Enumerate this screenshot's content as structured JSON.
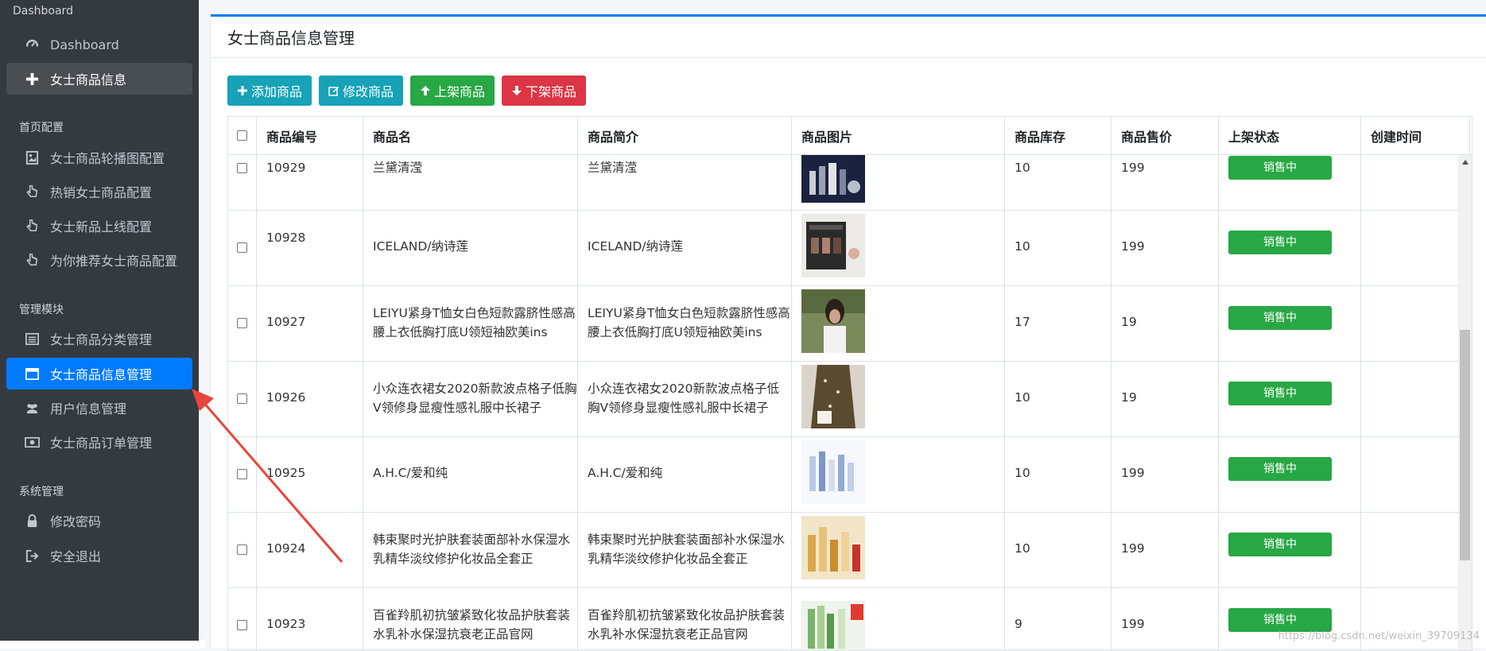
{
  "sidebar": {
    "top_header": "Dashboard",
    "items_main": [
      {
        "label": "Dashboard",
        "icon": "dashboard-icon"
      },
      {
        "label": "女士商品信息",
        "icon": "plus-icon"
      }
    ],
    "section_home": "首页配置",
    "items_home": [
      {
        "label": "女士商品轮播图配置",
        "icon": "image-icon"
      },
      {
        "label": "热销女士商品配置",
        "icon": "hand-pointer-icon"
      },
      {
        "label": "女士新品上线配置",
        "icon": "hand-pointer-icon"
      },
      {
        "label": "为你推荐女士商品配置",
        "icon": "hand-pointer-icon"
      }
    ],
    "section_manage": "管理模块",
    "items_manage": [
      {
        "label": "女士商品分类管理",
        "icon": "list-icon"
      },
      {
        "label": "女士商品信息管理",
        "icon": "window-icon"
      },
      {
        "label": "用户信息管理",
        "icon": "users-icon"
      },
      {
        "label": "女士商品订单管理",
        "icon": "money-icon"
      }
    ],
    "section_system": "系统管理",
    "items_system": [
      {
        "label": "修改密码",
        "icon": "lock-icon"
      },
      {
        "label": "安全退出",
        "icon": "sign-out-icon"
      }
    ]
  },
  "card": {
    "title": "女士商品信息管理"
  },
  "toolbar": {
    "add_label": "添加商品",
    "edit_label": "修改商品",
    "up_label": "上架商品",
    "down_label": "下架商品"
  },
  "table": {
    "columns": [
      "商品编号",
      "商品名",
      "商品简介",
      "商品图片",
      "商品库存",
      "商品售价",
      "上架状态",
      "创建时间"
    ],
    "rows": [
      {
        "id": "10929",
        "name": "兰黛清滢",
        "intro": "兰黛清滢",
        "stock": "10",
        "price": "199",
        "status": "销售中",
        "time": ""
      },
      {
        "id": "10928",
        "name": "ICELAND/纳诗莲",
        "intro": "ICELAND/纳诗莲",
        "stock": "10",
        "price": "199",
        "status": "销售中",
        "time": ""
      },
      {
        "id": "10927",
        "name": "LEIYU紧身T恤女白色短款露脐性感高腰上衣低胸打底U领短袖欧美ins",
        "intro": "LEIYU紧身T恤女白色短款露脐性感高腰上衣低胸打底U领短袖欧美ins",
        "stock": "17",
        "price": "19",
        "status": "销售中",
        "time": ""
      },
      {
        "id": "10926",
        "name": "小众连衣裙女2020新款波点格子低胸V领修身显瘦性感礼服中长裙子",
        "intro": "小众连衣裙女2020新款波点格子低胸V领修身显瘦性感礼服中长裙子",
        "stock": "10",
        "price": "19",
        "status": "销售中",
        "time": ""
      },
      {
        "id": "10925",
        "name": "A.H.C/爱和纯",
        "intro": "A.H.C/爱和纯",
        "stock": "10",
        "price": "199",
        "status": "销售中",
        "time": ""
      },
      {
        "id": "10924",
        "name": "韩束聚时光护肤套装面部补水保湿水乳精华淡纹修护化妆品全套正",
        "intro": "韩束聚时光护肤套装面部补水保湿水乳精华淡纹修护化妆品全套正",
        "stock": "10",
        "price": "199",
        "status": "销售中",
        "time": ""
      },
      {
        "id": "10923",
        "name": "百雀羚肌初抗皱紧致化妆品护肤套装水乳补水保湿抗衰老正品官网",
        "intro": "百雀羚肌初抗皱紧致化妆品护肤套装水乳补水保湿抗衰老正品官网",
        "stock": "9",
        "price": "199",
        "status": "销售中",
        "time": ""
      }
    ]
  },
  "watermark": "https://blog.csdn.net/weixin_39709134",
  "colors": {
    "sidebar_bg": "#343a40",
    "active": "#007bff",
    "info": "#17a2b8",
    "success": "#28a745",
    "danger": "#dc3545",
    "arrow": "#e8453c"
  }
}
